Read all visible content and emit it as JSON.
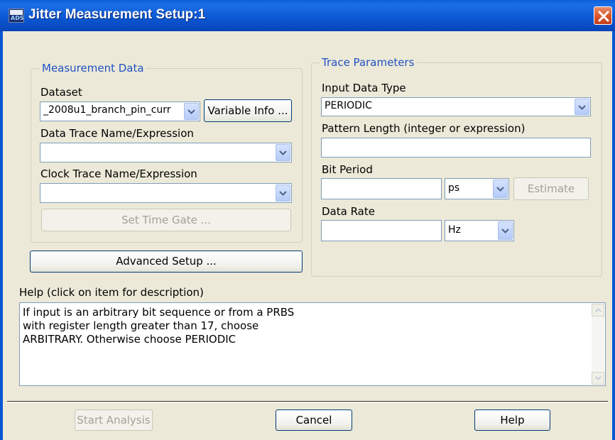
{
  "window": {
    "title": "Jitter Measurement Setup:1",
    "icon_text": "ADS"
  },
  "measurement": {
    "legend": "Measurement Data",
    "dataset_label": "Dataset",
    "dataset_value": "_2008u1_branch_pin_curr",
    "variable_info_button": "Variable Info ...",
    "data_trace_label": "Data Trace Name/Expression",
    "data_trace_value": "",
    "clock_trace_label": "Clock Trace Name/Expression",
    "clock_trace_value": "",
    "set_time_gate_button": "Set Time Gate ..."
  },
  "advanced_setup_button": "Advanced Setup ...",
  "trace": {
    "legend": "Trace Parameters",
    "input_type_label": "Input Data Type",
    "input_type_value": "PERIODIC",
    "pattern_length_label": "Pattern Length (integer or expression)",
    "pattern_length_value": "",
    "bit_period_label": "Bit Period",
    "bit_period_value": "",
    "bit_period_unit": "ps",
    "estimate_button": "Estimate",
    "data_rate_label": "Data Rate",
    "data_rate_value": "",
    "data_rate_unit": "Hz"
  },
  "help": {
    "label": "Help (click on item for description)",
    "text": "If input is an arbitrary bit sequence or from a PRBS\nwith register length greater than 17, choose\nARBITRARY. Otherwise choose PERIODIC"
  },
  "footer": {
    "start_analysis": "Start Analysis",
    "cancel": "Cancel",
    "help": "Help"
  },
  "colors": {
    "titlebar": "#0b56d2",
    "window_bg": "#ece9d8",
    "group_legend": "#2152c3",
    "close_button": "#d9542b"
  },
  "icons": [
    "app-icon",
    "close-icon",
    "chevron-down-icon",
    "scroll-up-icon",
    "scroll-down-icon"
  ]
}
